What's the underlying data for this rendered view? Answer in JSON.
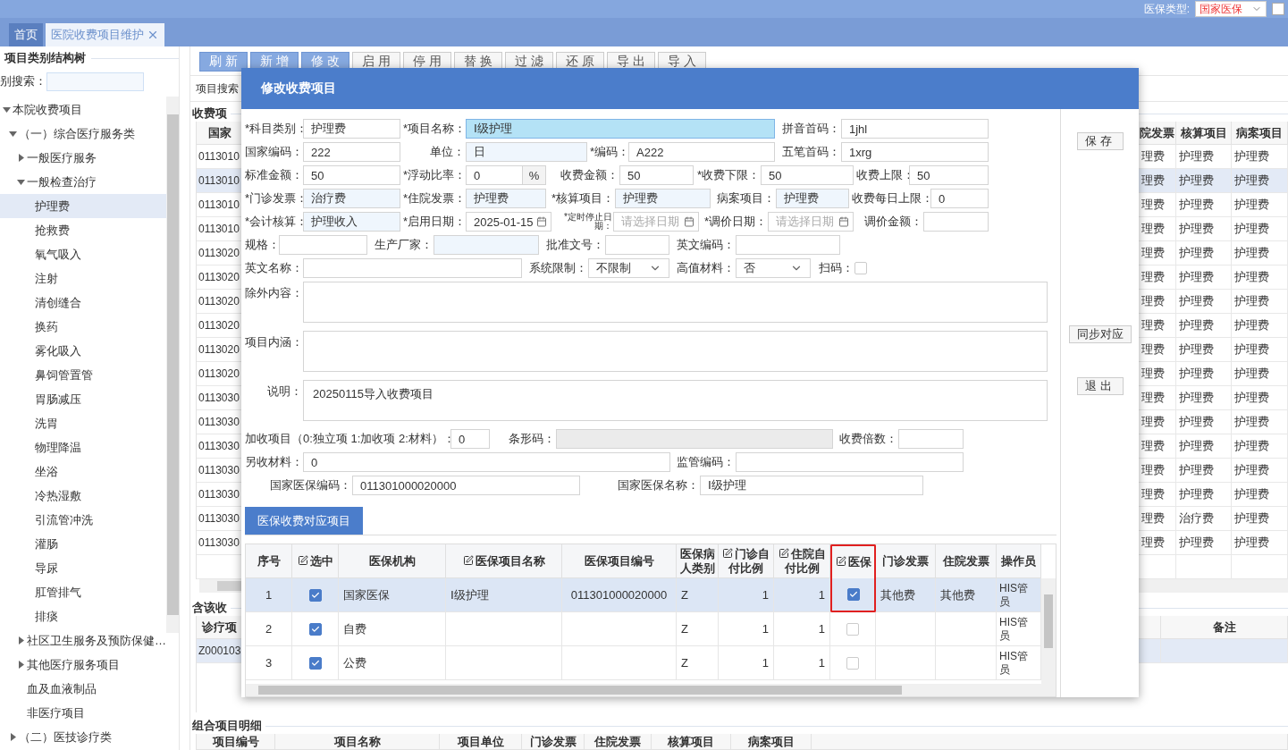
{
  "header": {
    "insurance_label": "医保类型:",
    "insurance_value": "国家医保",
    "checkbox_checked": false
  },
  "tabs": [
    {
      "label": "首页",
      "selected": true,
      "closable": false
    },
    {
      "label": "医院收费项目维护",
      "selected": false,
      "closable": true
    }
  ],
  "sidebar": {
    "title": "项目类别结构树",
    "search_label": "别搜索：",
    "tree": [
      {
        "label": "本院收费项目",
        "selected": false,
        "expanded": true,
        "children": [
          {
            "label": "（一）综合医疗服务类",
            "selected": false,
            "expanded": true,
            "children": [
              {
                "label": "一般医疗服务",
                "selected": false,
                "expanded": false
              },
              {
                "label": "一般检查治疗",
                "selected": false,
                "expanded": true,
                "children": [
                  {
                    "label": "护理费",
                    "selected": true
                  },
                  {
                    "label": "抢救费",
                    "selected": false
                  },
                  {
                    "label": "氧气吸入",
                    "selected": false
                  },
                  {
                    "label": "注射",
                    "selected": false
                  },
                  {
                    "label": "清创缝合",
                    "selected": false
                  },
                  {
                    "label": "换药",
                    "selected": false
                  },
                  {
                    "label": "雾化吸入",
                    "selected": false
                  },
                  {
                    "label": "鼻饲管置管",
                    "selected": false
                  },
                  {
                    "label": "胃肠减压",
                    "selected": false
                  },
                  {
                    "label": "洗胃",
                    "selected": false
                  },
                  {
                    "label": "物理降温",
                    "selected": false
                  },
                  {
                    "label": "坐浴",
                    "selected": false
                  },
                  {
                    "label": "冷热湿敷",
                    "selected": false
                  },
                  {
                    "label": "引流管冲洗",
                    "selected": false
                  },
                  {
                    "label": "灌肠",
                    "selected": false
                  },
                  {
                    "label": "导尿",
                    "selected": false
                  },
                  {
                    "label": "肛管排气",
                    "selected": false
                  },
                  {
                    "label": "排痰",
                    "selected": false
                  }
                ]
              },
              {
                "label": "社区卫生服务及预防保健…",
                "selected": false,
                "expanded": false
              },
              {
                "label": "其他医疗服务项目",
                "selected": false,
                "expanded": false
              },
              {
                "label": "血及血液制品",
                "selected": false
              },
              {
                "label": "非医疗项目",
                "selected": false
              }
            ]
          },
          {
            "label": "（二）医技诊疗类",
            "selected": false,
            "expanded": false
          }
        ]
      }
    ]
  },
  "toolbar": [
    {
      "label": "刷新",
      "primary": true
    },
    {
      "label": "新增",
      "primary": true
    },
    {
      "label": "修改",
      "primary": true
    },
    {
      "label": "启用",
      "primary": false
    },
    {
      "label": "停用",
      "primary": false
    },
    {
      "label": "替换",
      "primary": false
    },
    {
      "label": "过滤",
      "primary": false
    },
    {
      "label": "还原",
      "primary": false
    },
    {
      "label": "导出",
      "primary": false
    },
    {
      "label": "导入",
      "primary": false
    }
  ],
  "search_label": "项目搜索",
  "charge_table": {
    "legend": "收费项",
    "columns": [
      "国家",
      "院发票",
      "核算项目",
      "病案项目"
    ],
    "rows": [
      {
        "code": "0113010",
        "inpatient_invoice": "理费",
        "accounting_item": "护理费",
        "case_item": "护理费",
        "selected": false
      },
      {
        "code": "0113010",
        "inpatient_invoice": "理费",
        "accounting_item": "护理费",
        "case_item": "护理费",
        "selected": true
      },
      {
        "code": "0113010",
        "inpatient_invoice": "理费",
        "accounting_item": "护理费",
        "case_item": "护理费",
        "selected": false
      },
      {
        "code": "0113010",
        "inpatient_invoice": "理费",
        "accounting_item": "护理费",
        "case_item": "护理费",
        "selected": false
      },
      {
        "code": "0113020",
        "inpatient_invoice": "理费",
        "accounting_item": "护理费",
        "case_item": "护理费",
        "selected": false
      },
      {
        "code": "0113020",
        "inpatient_invoice": "理费",
        "accounting_item": "护理费",
        "case_item": "护理费",
        "selected": false
      },
      {
        "code": "0113020",
        "inpatient_invoice": "理费",
        "accounting_item": "护理费",
        "case_item": "护理费",
        "selected": false
      },
      {
        "code": "0113020",
        "inpatient_invoice": "理费",
        "accounting_item": "护理费",
        "case_item": "护理费",
        "selected": false
      },
      {
        "code": "0113020",
        "inpatient_invoice": "理费",
        "accounting_item": "护理费",
        "case_item": "护理费",
        "selected": false
      },
      {
        "code": "0113020",
        "inpatient_invoice": "理费",
        "accounting_item": "护理费",
        "case_item": "护理费",
        "selected": false
      },
      {
        "code": "0113030",
        "inpatient_invoice": "理费",
        "accounting_item": "护理费",
        "case_item": "护理费",
        "selected": false
      },
      {
        "code": "0113030",
        "inpatient_invoice": "理费",
        "accounting_item": "护理费",
        "case_item": "护理费",
        "selected": false
      },
      {
        "code": "0113030",
        "inpatient_invoice": "理费",
        "accounting_item": "护理费",
        "case_item": "护理费",
        "selected": false
      },
      {
        "code": "0113030",
        "inpatient_invoice": "理费",
        "accounting_item": "护理费",
        "case_item": "护理费",
        "selected": false
      },
      {
        "code": "0113030",
        "inpatient_invoice": "理费",
        "accounting_item": "护理费",
        "case_item": "护理费",
        "selected": false
      },
      {
        "code": "0113030",
        "inpatient_invoice": "理费",
        "accounting_item": "治疗费",
        "case_item": "护理费",
        "selected": false
      },
      {
        "code": "0113030",
        "inpatient_invoice": "理费",
        "accounting_item": "护理费",
        "case_item": "护理费",
        "selected": false
      }
    ]
  },
  "related_panel": {
    "legend": "含该收",
    "columns": [
      "诊疗项",
      "备注"
    ],
    "rows": [
      {
        "code": "Z000103",
        "selected": true
      }
    ]
  },
  "combo_panel": {
    "legend": "组合项目明细",
    "columns": [
      "项目编号",
      "项目名称",
      "项目单位",
      "门诊发票",
      "住院发票",
      "核算项目",
      "病案项目"
    ]
  },
  "dialog": {
    "title": "修改收费项目",
    "form_rows": [
      [
        {
          "label": "*科目类别：",
          "kind": "text",
          "value": "护理费"
        },
        {
          "label": "*项目名称：",
          "kind": "focused",
          "value": "Ⅰ级护理"
        },
        {
          "label": "拼音首码：",
          "kind": "text",
          "value": "1jhl"
        }
      ],
      [
        {
          "label": "国家编码：",
          "kind": "text",
          "value": "222"
        },
        {
          "label": "单位：",
          "kind": "lookup",
          "value": "日"
        },
        {
          "label": "*编码：",
          "kind": "text",
          "value": "A222"
        },
        {
          "label": "五笔首码：",
          "kind": "text",
          "value": "1xrg"
        }
      ],
      [
        {
          "label": "标准金额：",
          "kind": "text",
          "value": "50"
        },
        {
          "label": "*浮动比率：",
          "kind": "percent",
          "value": "0",
          "unit": "%"
        },
        {
          "label": "收费金额：",
          "kind": "text",
          "value": "50"
        },
        {
          "label": "*收费下限：",
          "kind": "text",
          "value": "50"
        },
        {
          "label": "收费上限：",
          "kind": "text",
          "value": "50"
        }
      ],
      [
        {
          "label": "*门诊发票：",
          "kind": "lookup",
          "value": "治疗费"
        },
        {
          "label": "*住院发票：",
          "kind": "lookup",
          "value": "护理费"
        },
        {
          "label": "*核算项目：",
          "kind": "lookup",
          "value": "护理费"
        },
        {
          "label": "病案项目：",
          "kind": "lookup",
          "value": "护理费"
        },
        {
          "label": "收费每日上限：",
          "kind": "text",
          "value": "0"
        }
      ],
      [
        {
          "label": "*会计核算：",
          "kind": "lookup",
          "value": "护理收入"
        },
        {
          "label": "*启用日期：",
          "kind": "date",
          "value": "2025-01-15"
        },
        {
          "label": "*定时停止日期：",
          "kind": "date",
          "small_label": true,
          "placeholder": "请选择日期"
        },
        {
          "label": "*调价日期：",
          "kind": "date",
          "placeholder": "请选择日期"
        },
        {
          "label": "调价金额：",
          "kind": "text"
        }
      ],
      [
        {
          "label": "规格：",
          "kind": "text"
        },
        {
          "label": "生产厂家：",
          "kind": "lookup"
        },
        {
          "label": "批准文号：",
          "kind": "text"
        },
        {
          "label": "英文编码：",
          "kind": "text"
        }
      ],
      [
        {
          "label": "英文名称：",
          "kind": "text"
        },
        {
          "label": "系统限制：",
          "kind": "select",
          "value": "不限制"
        },
        {
          "label": "高值材料：",
          "kind": "select",
          "value": "否"
        },
        {
          "label": "扫码：",
          "kind": "checkbox",
          "checked": false
        }
      ],
      [
        {
          "label": "除外内容：",
          "kind": "textarea"
        }
      ],
      [
        {
          "label": "项目内涵：",
          "kind": "textarea"
        }
      ],
      [
        {
          "label": "说明：",
          "kind": "textarea",
          "value": "20250115导入收费项目"
        }
      ],
      [
        {
          "label": "加收项目（0:独立项 1:加收项 2:材料）：",
          "kind": "text",
          "value": "0"
        },
        {
          "label": "条形码：",
          "kind": "disabled"
        },
        {
          "label": "收费倍数：",
          "kind": "text"
        }
      ],
      [
        {
          "label": "另收材料：",
          "kind": "text",
          "value": "0"
        },
        {
          "label": "监管编码：",
          "kind": "text"
        }
      ],
      [
        {
          "label": "国家医保编码：",
          "kind": "text",
          "value": "011301000020000"
        },
        {
          "label": "国家医保名称：",
          "kind": "text",
          "value": "Ⅰ级护理"
        }
      ]
    ],
    "side_buttons": [
      "保存",
      "同步对应",
      "退出"
    ],
    "section_tab": "医保收费对应项目",
    "table": {
      "columns": [
        {
          "label": "序号",
          "editable": false,
          "highlighted": false
        },
        {
          "label": "选中",
          "editable": true,
          "highlighted": false
        },
        {
          "label": "医保机构",
          "editable": false,
          "highlighted": false
        },
        {
          "label": "医保项目名称",
          "editable": true,
          "highlighted": false
        },
        {
          "label": "医保项目编号",
          "editable": false,
          "highlighted": false
        },
        {
          "label": "医保病人类别",
          "editable": false,
          "highlighted": false
        },
        {
          "label": "门诊自付比例",
          "editable": true,
          "highlighted": false
        },
        {
          "label": "住院自付比例",
          "editable": true,
          "highlighted": false
        },
        {
          "label": "医保",
          "editable": true,
          "highlighted": true
        },
        {
          "label": "门诊发票",
          "editable": false,
          "highlighted": false
        },
        {
          "label": "住院发票",
          "editable": false,
          "highlighted": false
        },
        {
          "label": "操作员",
          "editable": false,
          "highlighted": false
        }
      ],
      "rows": [
        {
          "no": "1",
          "checked": true,
          "org": "国家医保",
          "item_name": "Ⅰ级护理",
          "item_code": "011301000020000",
          "patient_type": "Z",
          "outpatient_ratio": "1",
          "inpatient_ratio": "1",
          "insured": true,
          "outpatient_invoice": "其他费",
          "inpatient_invoice": "其他费",
          "operator": "HIS管员",
          "selected": true
        },
        {
          "no": "2",
          "checked": true,
          "org": "自费",
          "patient_type": "Z",
          "outpatient_ratio": "1",
          "inpatient_ratio": "1",
          "insured": false,
          "operator": "HIS管员",
          "selected": false
        },
        {
          "no": "3",
          "checked": true,
          "org": "公费",
          "patient_type": "Z",
          "outpatient_ratio": "1",
          "inpatient_ratio": "1",
          "insured": false,
          "operator": "HIS管员",
          "selected": false
        }
      ]
    }
  }
}
